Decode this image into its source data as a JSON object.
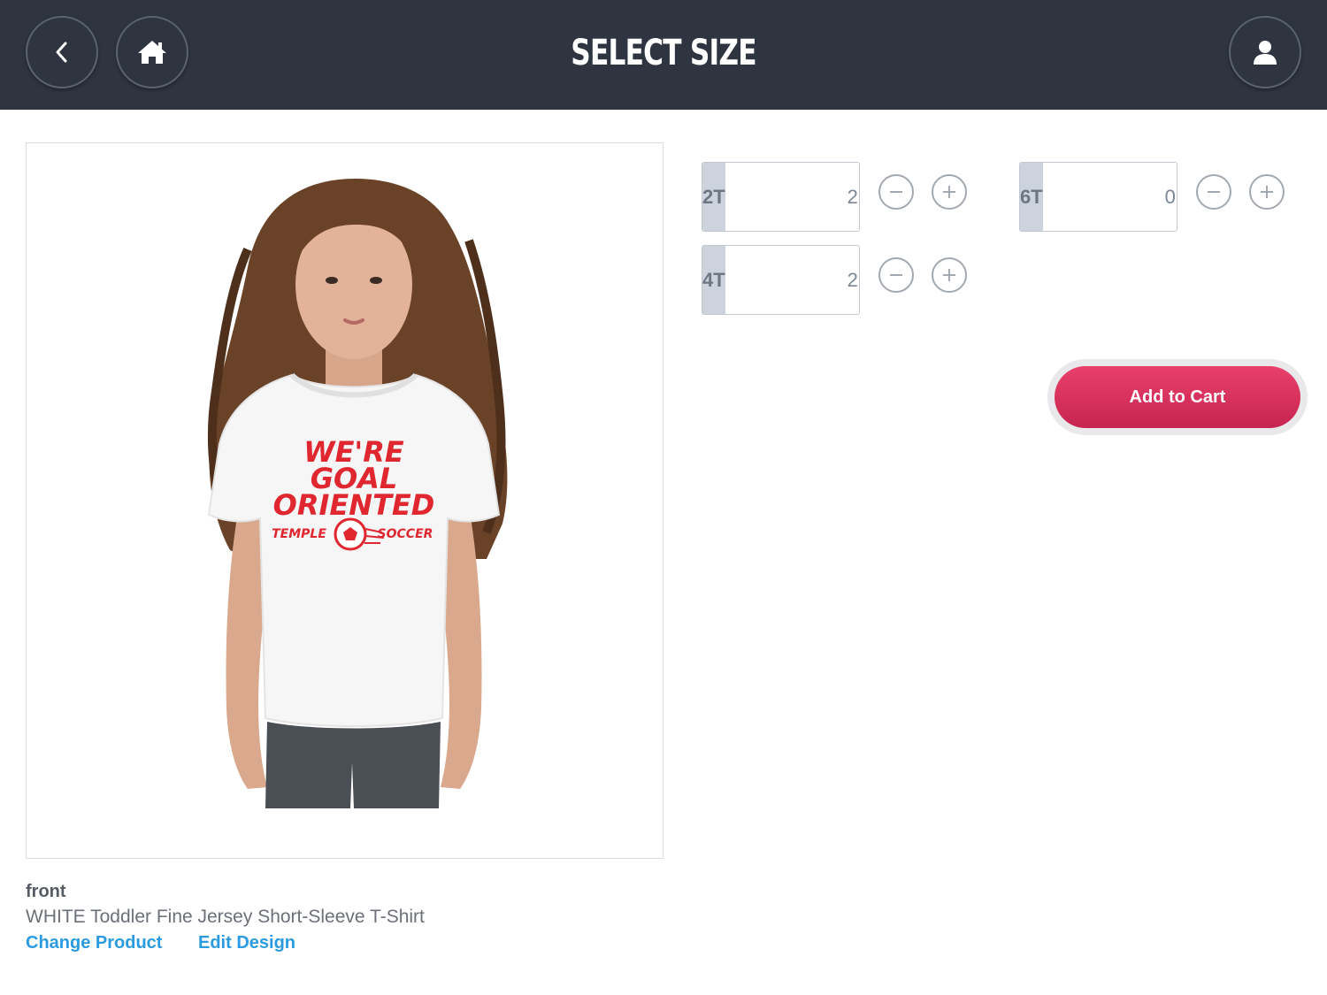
{
  "header": {
    "title": "SELECT SIZE",
    "back_icon": "chevron-left-icon",
    "home_icon": "home-icon",
    "user_icon": "user-icon"
  },
  "product": {
    "side": "front",
    "name": "WHITE Toddler Fine Jersey Short-Sleeve T-Shirt",
    "shirt_print": {
      "line1": "WE'RE",
      "line2": "GOAL",
      "line3": "ORIENTED",
      "left_word": "TEMPLE",
      "right_word": "SOCCER"
    },
    "links": {
      "change_product": "Change Product",
      "edit_design": "Edit Design"
    }
  },
  "sizes": [
    {
      "label": "2T",
      "qty": "2"
    },
    {
      "label": "4T",
      "qty": "2"
    },
    {
      "label": "6T",
      "qty": "0"
    }
  ],
  "cart": {
    "label": "Add to Cart"
  },
  "colors": {
    "header_bg": "#2f3540",
    "size_label_bg": "#ccd3dc",
    "link": "#2a9be0",
    "cart_button": "#d63360",
    "print_red": "#e0262f"
  }
}
